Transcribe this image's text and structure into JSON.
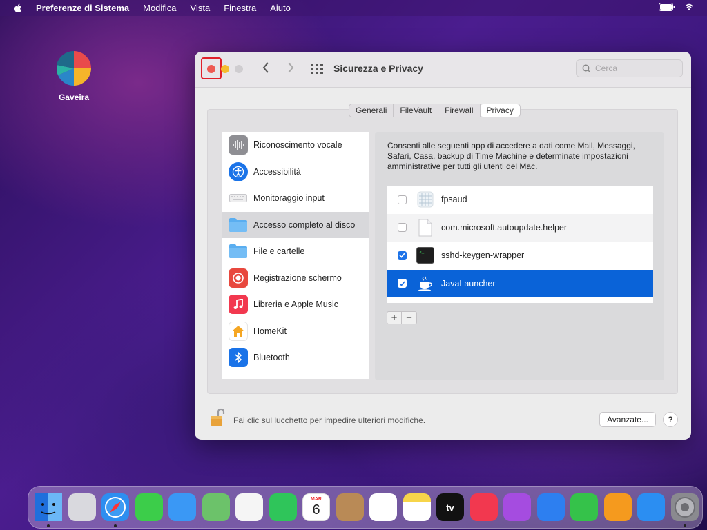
{
  "menubar": {
    "app_name": "Preferenze di Sistema",
    "items": [
      "Modifica",
      "Vista",
      "Finestra",
      "Aiuto"
    ]
  },
  "desktop": {
    "icon_label": "Gaveira"
  },
  "window": {
    "title": "Sicurezza e Privacy",
    "search_placeholder": "Cerca",
    "tabs": [
      {
        "label": "Generali",
        "active": false
      },
      {
        "label": "FileVault",
        "active": false
      },
      {
        "label": "Firewall",
        "active": false
      },
      {
        "label": "Privacy",
        "active": true
      }
    ],
    "sidebar": [
      {
        "label": "Riconoscimento vocale",
        "icon": "waveform-icon"
      },
      {
        "label": "Accessibilità",
        "icon": "accessibility-icon"
      },
      {
        "label": "Monitoraggio input",
        "icon": "keyboard-icon"
      },
      {
        "label": "Accesso completo al disco",
        "icon": "folder-icon",
        "selected": true
      },
      {
        "label": "File e cartelle",
        "icon": "folder-icon"
      },
      {
        "label": "Registrazione schermo",
        "icon": "screen-record-icon"
      },
      {
        "label": "Libreria e Apple Music",
        "icon": "music-icon"
      },
      {
        "label": "HomeKit",
        "icon": "home-icon"
      },
      {
        "label": "Bluetooth",
        "icon": "bluetooth-icon"
      }
    ],
    "description": "Consenti alle seguenti app di accedere a dati come Mail, Messaggi, Safari, Casa, backup di Time Machine e determinate impostazioni amministrative per tutti gli utenti del Mac.",
    "apps": [
      {
        "name": "fpsaud",
        "checked": false,
        "icon": "app-grid-icon"
      },
      {
        "name": "com.microsoft.autoupdate.helper",
        "checked": false,
        "icon": "document-icon"
      },
      {
        "name": "sshd-keygen-wrapper",
        "checked": true,
        "icon": "terminal-icon"
      },
      {
        "name": "JavaLauncher",
        "checked": true,
        "icon": "java-cup-icon",
        "selected": true
      }
    ],
    "add_label": "+",
    "remove_label": "−",
    "footer_text": "Fai clic sul lucchetto per impedire ulteriori modifiche.",
    "advanced_button": "Avanzate...",
    "help_button": "?"
  },
  "dock": {
    "calendar_month": "MAR",
    "calendar_day": "6",
    "tv_label": "tv",
    "apps": [
      {
        "name": "finder-icon",
        "color": "#3d8ff0",
        "running": true
      },
      {
        "name": "launchpad-icon",
        "color": "#d9d9de",
        "running": false
      },
      {
        "name": "safari-icon",
        "color": "#2d8ef0",
        "running": true
      },
      {
        "name": "messages-icon",
        "color": "#3ccd4a",
        "running": false
      },
      {
        "name": "mail-icon",
        "color": "#3a98f5",
        "running": false
      },
      {
        "name": "maps-icon",
        "color": "#6cc26a",
        "running": false
      },
      {
        "name": "photos-icon",
        "color": "#f5f5f5",
        "running": false
      },
      {
        "name": "facetime-icon",
        "color": "#2fc55a",
        "running": false
      },
      {
        "name": "calendar-icon",
        "color": "#ffffff",
        "running": false
      },
      {
        "name": "contacts-icon",
        "color": "#b98a56",
        "running": false
      },
      {
        "name": "reminders-icon",
        "color": "#ffffff",
        "running": false
      },
      {
        "name": "notes-icon",
        "color": "#f7d54a",
        "running": false
      },
      {
        "name": "apple-tv-icon",
        "color": "#111111",
        "running": false
      },
      {
        "name": "music-icon",
        "color": "#f2384f",
        "running": false
      },
      {
        "name": "podcasts-icon",
        "color": "#a54ce0",
        "running": false
      },
      {
        "name": "keynote-icon",
        "color": "#2d7ff0",
        "running": false
      },
      {
        "name": "numbers-icon",
        "color": "#35c24a",
        "running": false
      },
      {
        "name": "pages-icon",
        "color": "#f59a1e",
        "running": false
      },
      {
        "name": "app-store-icon",
        "color": "#2b8ef2",
        "running": false
      },
      {
        "name": "system-preferences-icon",
        "color": "#8a8a8f",
        "running": true
      }
    ]
  }
}
